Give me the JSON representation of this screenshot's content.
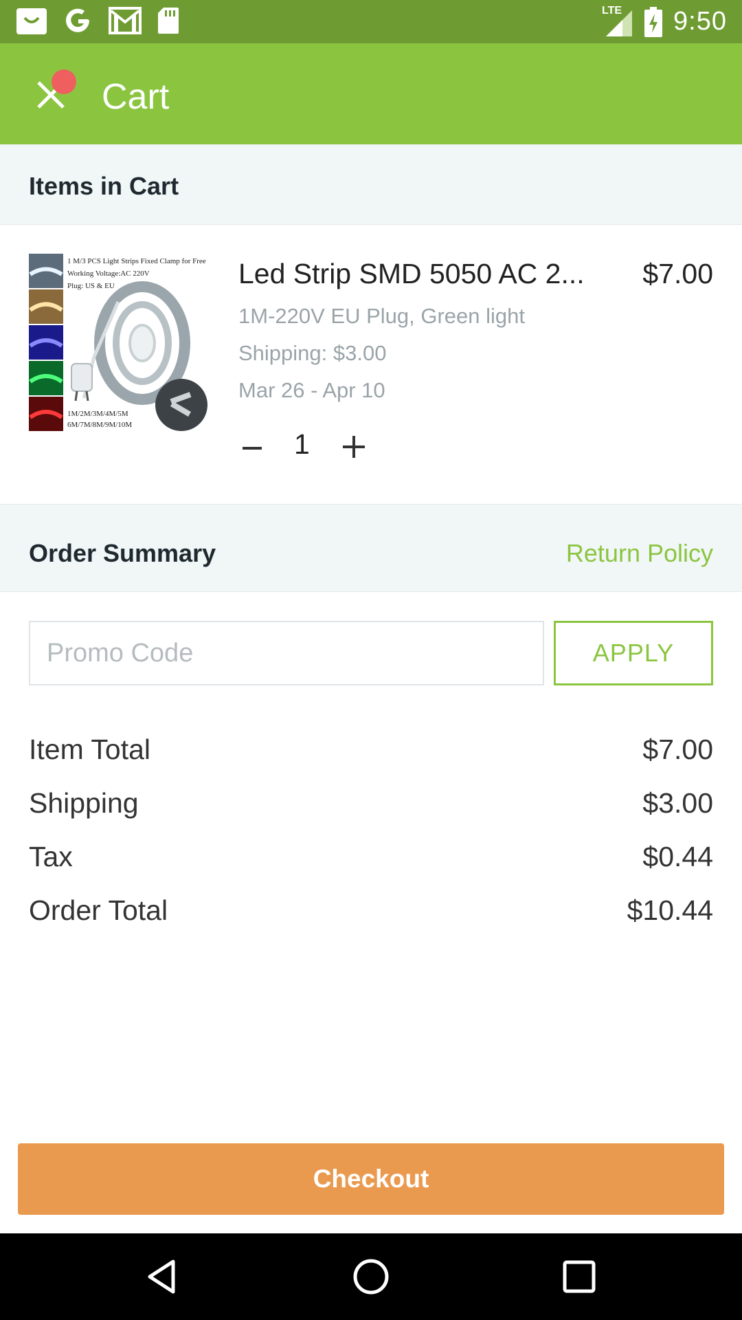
{
  "status_bar": {
    "time": "9:50",
    "network": "LTE",
    "left_icons": [
      "shop-icon",
      "google-icon",
      "gmail-icon",
      "sd-card-icon"
    ],
    "colors": {
      "background": "#6f9c32"
    }
  },
  "app_bar": {
    "title": "Cart",
    "colors": {
      "background": "#8bc540",
      "notification_dot": "#ef5f5f"
    }
  },
  "items_section": {
    "title": "Items in Cart",
    "items": [
      {
        "title": "Led Strip SMD 5050 AC 2...",
        "price": "$7.00",
        "variant": "1M-220V EU Plug, Green light",
        "shipping": "Shipping: $3.00",
        "delivery": "Mar 26 - Apr 10",
        "quantity": "1",
        "image": {
          "line1": "1 M/3 PCS Light Strips Fixed Clamp for Free",
          "line2": "Working Voltage:AC 220V",
          "line3": "Plug: US & EU",
          "line4": "1M/2M/3M/4M/5M",
          "line5": "6M/7M/8M/9M/10M"
        }
      }
    ]
  },
  "order_summary": {
    "title": "Order Summary",
    "return_policy": "Return Policy",
    "promo_placeholder": "Promo Code",
    "apply_label": "APPLY",
    "rows": [
      {
        "label": "Item Total",
        "value": "$7.00"
      },
      {
        "label": "Shipping",
        "value": "$3.00"
      },
      {
        "label": "Tax",
        "value": "$0.44"
      },
      {
        "label": "Order Total",
        "value": "$10.44"
      }
    ]
  },
  "checkout": {
    "label": "Checkout",
    "color": "#ea9a4f"
  },
  "nav_bar": {
    "buttons": [
      "back-icon",
      "home-icon",
      "recents-icon"
    ]
  }
}
